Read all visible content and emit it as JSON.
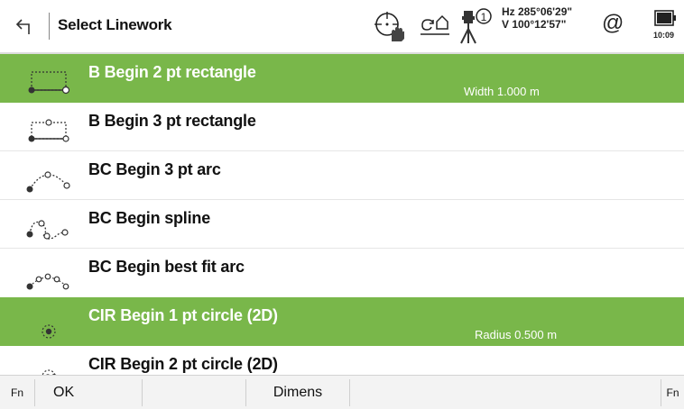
{
  "header": {
    "title": "Select Linework",
    "back_icon": "back-arrow-icon",
    "hz_angle": "Hz 285°06'29\"",
    "v_angle": "V  100°12'57\"",
    "at_symbol": "@",
    "time": "10:09",
    "instrument_face": "1"
  },
  "list": {
    "items": [
      {
        "label": "B Begin 2 pt rectangle",
        "detail": "Width 1.000 m",
        "selected": true,
        "icon": "rectangle-2pt-icon"
      },
      {
        "label": "B Begin 3 pt rectangle",
        "detail": "",
        "selected": false,
        "icon": "rectangle-3pt-icon"
      },
      {
        "label": "BC Begin 3 pt arc",
        "detail": "",
        "selected": false,
        "icon": "arc-3pt-icon"
      },
      {
        "label": "BC Begin spline",
        "detail": "",
        "selected": false,
        "icon": "spline-icon"
      },
      {
        "label": "BC Begin best fit arc",
        "detail": "",
        "selected": false,
        "icon": "best-fit-arc-icon"
      },
      {
        "label": "CIR Begin 1 pt circle (2D)",
        "detail": "Radius 0.500 m",
        "selected": true,
        "icon": "circle-1pt-icon"
      },
      {
        "label": "CIR Begin 2 pt circle (2D)",
        "detail": "",
        "selected": false,
        "icon": "circle-2pt-icon"
      }
    ]
  },
  "footer": {
    "fn_left": "Fn",
    "ok": "OK",
    "dimens": "Dimens",
    "fn_right": "Fn"
  },
  "colors": {
    "selected_row": "#79b74a",
    "header_bg": "#ffffff",
    "footer_bg": "#f3f3f3"
  }
}
